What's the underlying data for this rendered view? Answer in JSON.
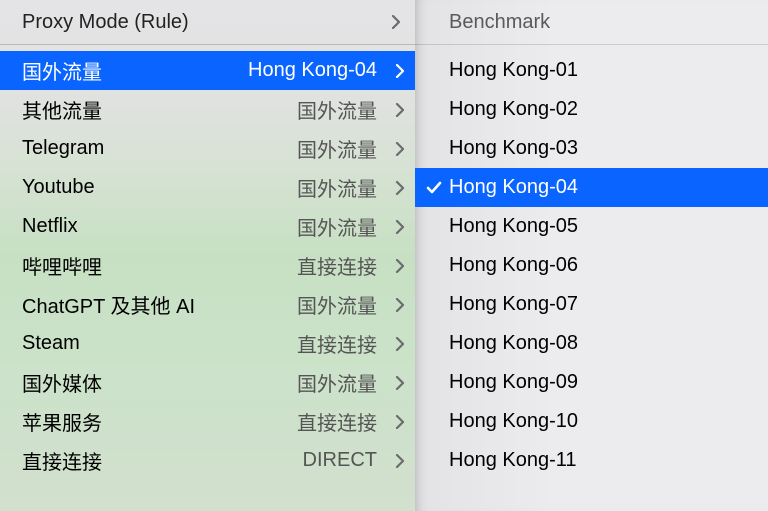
{
  "left": {
    "header": "Proxy Mode (Rule)",
    "selected_index": 0,
    "rules": [
      {
        "name": "国外流量",
        "value": "Hong Kong-04"
      },
      {
        "name": "其他流量",
        "value": "国外流量"
      },
      {
        "name": "Telegram",
        "value": "国外流量"
      },
      {
        "name": "Youtube",
        "value": "国外流量"
      },
      {
        "name": "Netflix",
        "value": "国外流量"
      },
      {
        "name": "哔哩哔哩",
        "value": "直接连接"
      },
      {
        "name": "ChatGPT 及其他 AI",
        "value": "国外流量"
      },
      {
        "name": "Steam",
        "value": "直接连接"
      },
      {
        "name": "国外媒体",
        "value": "国外流量"
      },
      {
        "name": "苹果服务",
        "value": "直接连接"
      },
      {
        "name": "直接连接",
        "value": "DIRECT"
      }
    ]
  },
  "right": {
    "header": "Benchmark",
    "selected_index": 3,
    "servers": [
      "Hong Kong-01",
      "Hong Kong-02",
      "Hong Kong-03",
      "Hong Kong-04",
      "Hong Kong-05",
      "Hong Kong-06",
      "Hong Kong-07",
      "Hong Kong-08",
      "Hong Kong-09",
      "Hong Kong-10",
      "Hong Kong-11"
    ]
  },
  "colors": {
    "accent": "#0a64ff"
  }
}
